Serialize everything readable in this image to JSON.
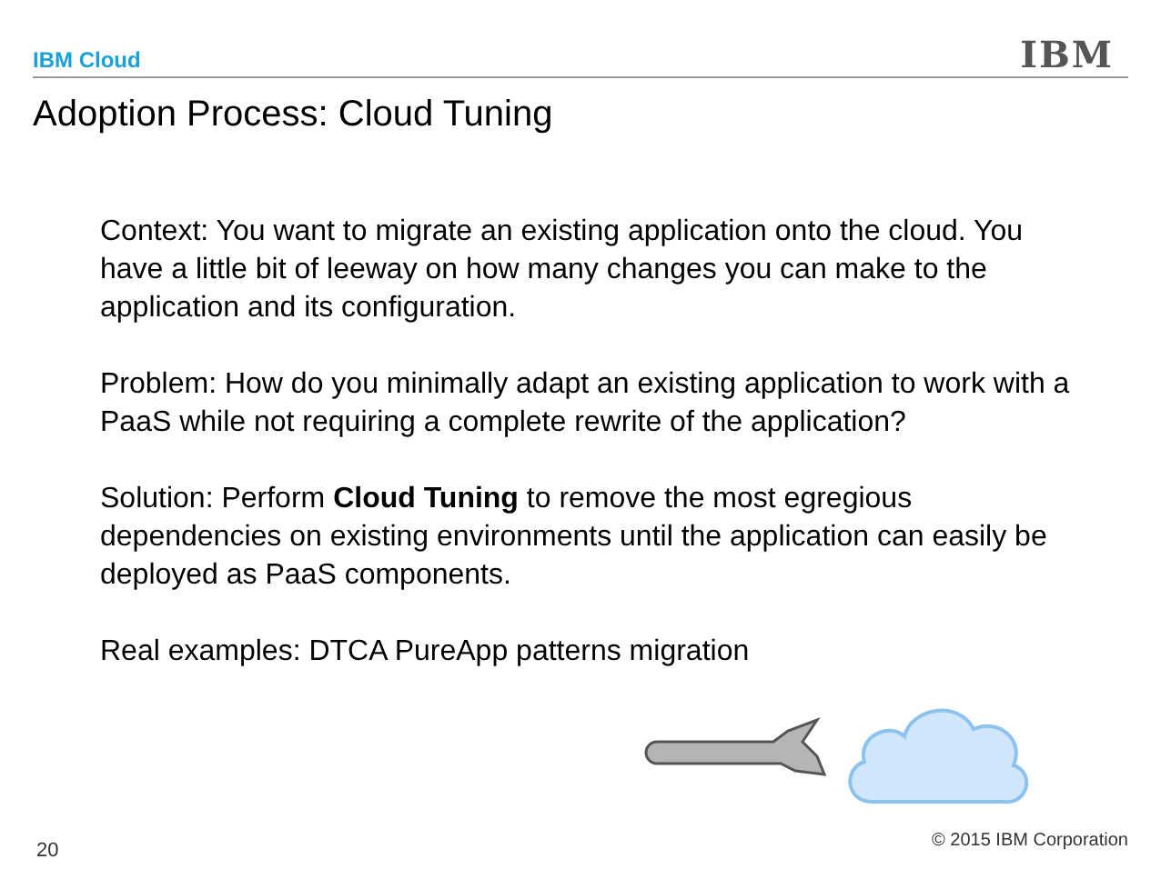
{
  "header": {
    "label": "IBM Cloud",
    "logo": "IBM"
  },
  "title": "Adoption Process: Cloud Tuning",
  "paragraphs": [
    "Context: You want to migrate an existing application onto the cloud.  You have a little bit of leeway on how many changes you can make to the application and its configuration.",
    "Problem: How do you minimally adapt an existing application to work with a PaaS while not requiring a complete rewrite of the application?",
    "Solution: Perform **Cloud Tuning** to remove the most egregious dependencies on existing environments until the application can easily be deployed as PaaS components.",
    "Real examples: DTCA PureApp patterns migration"
  ],
  "footer": {
    "page_number": "20",
    "copyright": "© 2015 IBM Corporation"
  }
}
